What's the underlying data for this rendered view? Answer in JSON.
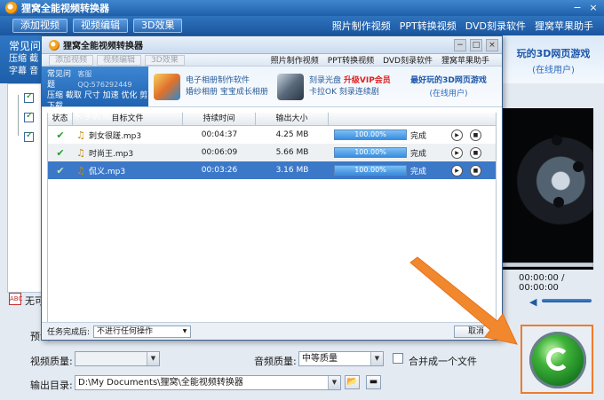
{
  "main": {
    "title": "狸窝全能视频转换器",
    "toolbar": [
      "添加视频",
      "视频编辑",
      "3D效果"
    ],
    "nav": [
      "照片制作视频",
      "PPT转换视频",
      "DVD刻录软件",
      "狸窝苹果助手"
    ],
    "window_controls": [
      "−",
      "×"
    ],
    "sidebar_header": {
      "faq": "常见问",
      "line2": "压缩 截",
      "line3": "字幕 音"
    },
    "promo": {
      "line1": "玩的3D网页游戏",
      "line2": "(在线用户)"
    },
    "player": {
      "time": "00:00:00 / 00:00:00"
    },
    "no_caption": "无可",
    "preset_label": "预设",
    "video_quality_label": "视频质量:",
    "video_quality_value": "",
    "audio_quality_label": "音频质量:",
    "audio_quality_value": "中等质量",
    "merge_label": "合并成一个文件",
    "output_label": "输出目录:",
    "output_path": "D:\\My Documents\\狸窝\\全能视频转换器"
  },
  "dialog": {
    "title": "狸窝全能视频转换器",
    "toolbar": [
      "添加视频",
      "视频编辑",
      "3D效果"
    ],
    "nav": [
      "照片制作视频",
      "PPT转换视频",
      "DVD刻录软件",
      "狸窝苹果助手"
    ],
    "ads": {
      "faq_title": "常见问题",
      "faq_qq": "客服QQ:576292449",
      "faq_line2": "压缩 截取 尺寸 加速 优化 剪下载",
      "faq_line3": "字幕 音乐 手机 照片",
      "ad1_line1": "电子相册制作软件",
      "ad1_line2": "婚纱相册 宝宝成长相册",
      "ad2_line1": "刻录光盘",
      "ad2_hot": "升级VIP会员",
      "ad2_line2": "卡拉OK 刻录连续剧",
      "ad3_line1": "最好玩的3D网页游戏",
      "ad3_line2": "(在线用户)"
    },
    "columns": [
      "状态",
      "目标文件",
      "持续时间",
      "输出大小",
      ""
    ],
    "rows": [
      {
        "name": "刺女很蹉.mp3",
        "duration": "00:04:37",
        "size": "4.25 MB",
        "progress": "100.00%",
        "status": "完成"
      },
      {
        "name": "时尚王.mp3",
        "duration": "00:06:09",
        "size": "5.66 MB",
        "progress": "100.00%",
        "status": "完成"
      },
      {
        "name": "侃义.mp3",
        "duration": "00:03:26",
        "size": "3.16 MB",
        "progress": "100.00%",
        "status": "完成"
      }
    ],
    "after_label": "任务完成后:",
    "after_value": "不进行任何操作",
    "cancel": "取消"
  }
}
